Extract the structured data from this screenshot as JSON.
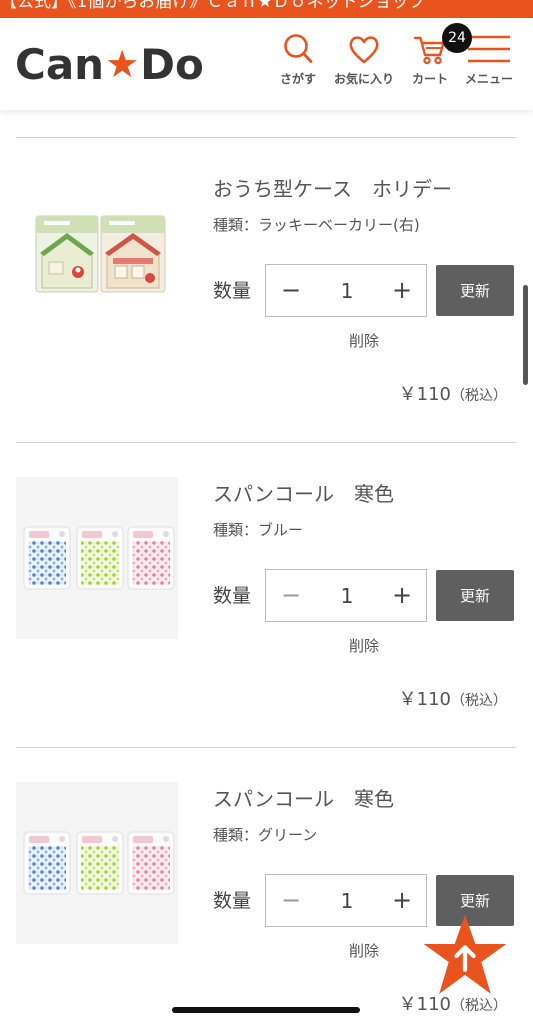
{
  "banner": {
    "text": "【公式】《1個からお届け》Ｃａｎ★Ｄｏネットショップ"
  },
  "header": {
    "logo": {
      "part1": "Can",
      "star": "★",
      "part2": "Do"
    },
    "nav": {
      "search": {
        "label": "さがす",
        "icon": "search-icon"
      },
      "favorites": {
        "label": "お気に入り",
        "icon": "heart-icon"
      },
      "cart": {
        "label": "カート",
        "icon": "cart-icon",
        "badge_count": "24"
      },
      "menu": {
        "label": "メニュー",
        "icon": "hamburger-menu-icon"
      }
    }
  },
  "cart": {
    "items": [
      {
        "name": "おうち型ケース　ホリデー",
        "variant": "種類：ラッキーベーカリー(右)",
        "quantity_label": "数量",
        "minus": "−",
        "quantity": "1",
        "plus": "+",
        "update_label": "更新",
        "delete_label": "削除",
        "price": "￥110",
        "tax_note": "（税込）"
      },
      {
        "name": "スパンコール　寒色",
        "variant": "種類：ブルー",
        "quantity_label": "数量",
        "minus": "−",
        "quantity": "1",
        "plus": "+",
        "update_label": "更新",
        "delete_label": "削除",
        "price": "￥110",
        "tax_note": "（税込）"
      },
      {
        "name": "スパンコール　寒色",
        "variant": "種類：グリーン",
        "quantity_label": "数量",
        "minus": "−",
        "quantity": "1",
        "plus": "+",
        "update_label": "更新",
        "delete_label": "削除",
        "price": "￥110",
        "tax_note": "（税込）"
      }
    ]
  },
  "scroll_to_top": {
    "icon": "arrow-up-icon"
  },
  "colors": {
    "brand_orange": "#e9531d",
    "update_button": "#5f5f5f",
    "text_gray": "#555555",
    "badge_black": "#111111",
    "divider": "#d3d3d3"
  }
}
